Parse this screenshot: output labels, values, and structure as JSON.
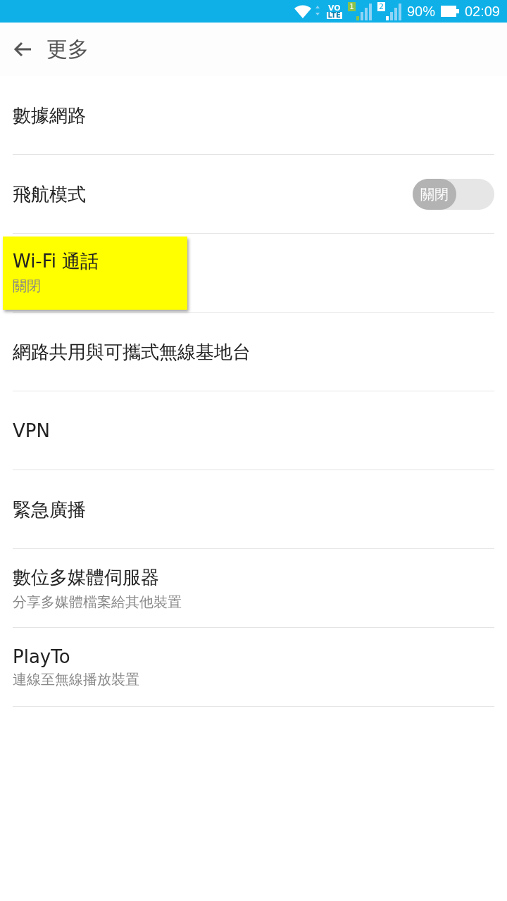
{
  "status_bar": {
    "volte": {
      "top": "VO",
      "bottom": "LTE"
    },
    "sims": [
      "1",
      "2"
    ],
    "battery": "90%",
    "time": "02:09"
  },
  "app_bar": {
    "title": "更多"
  },
  "items": [
    {
      "kind": "plain",
      "title": "數據網路",
      "highlighted": false
    },
    {
      "kind": "toggle",
      "title": "飛航模式",
      "on": false,
      "toggle_label": "關閉",
      "highlighted": false
    },
    {
      "kind": "plain",
      "title": "Wi-Fi 通話",
      "summary": "關閉",
      "highlighted": true
    },
    {
      "kind": "plain",
      "title": "網路共用與可攜式無線基地台",
      "highlighted": false
    },
    {
      "kind": "plain",
      "title": "VPN",
      "highlighted": false
    },
    {
      "kind": "plain",
      "title": "緊急廣播",
      "highlighted": false
    },
    {
      "kind": "plain",
      "title": "數位多媒體伺服器",
      "summary": "分享多媒體檔案給其他裝置",
      "highlighted": false
    },
    {
      "kind": "plain",
      "title": "PlayTo",
      "summary": "連線至無線播放裝置",
      "highlighted": false
    }
  ]
}
